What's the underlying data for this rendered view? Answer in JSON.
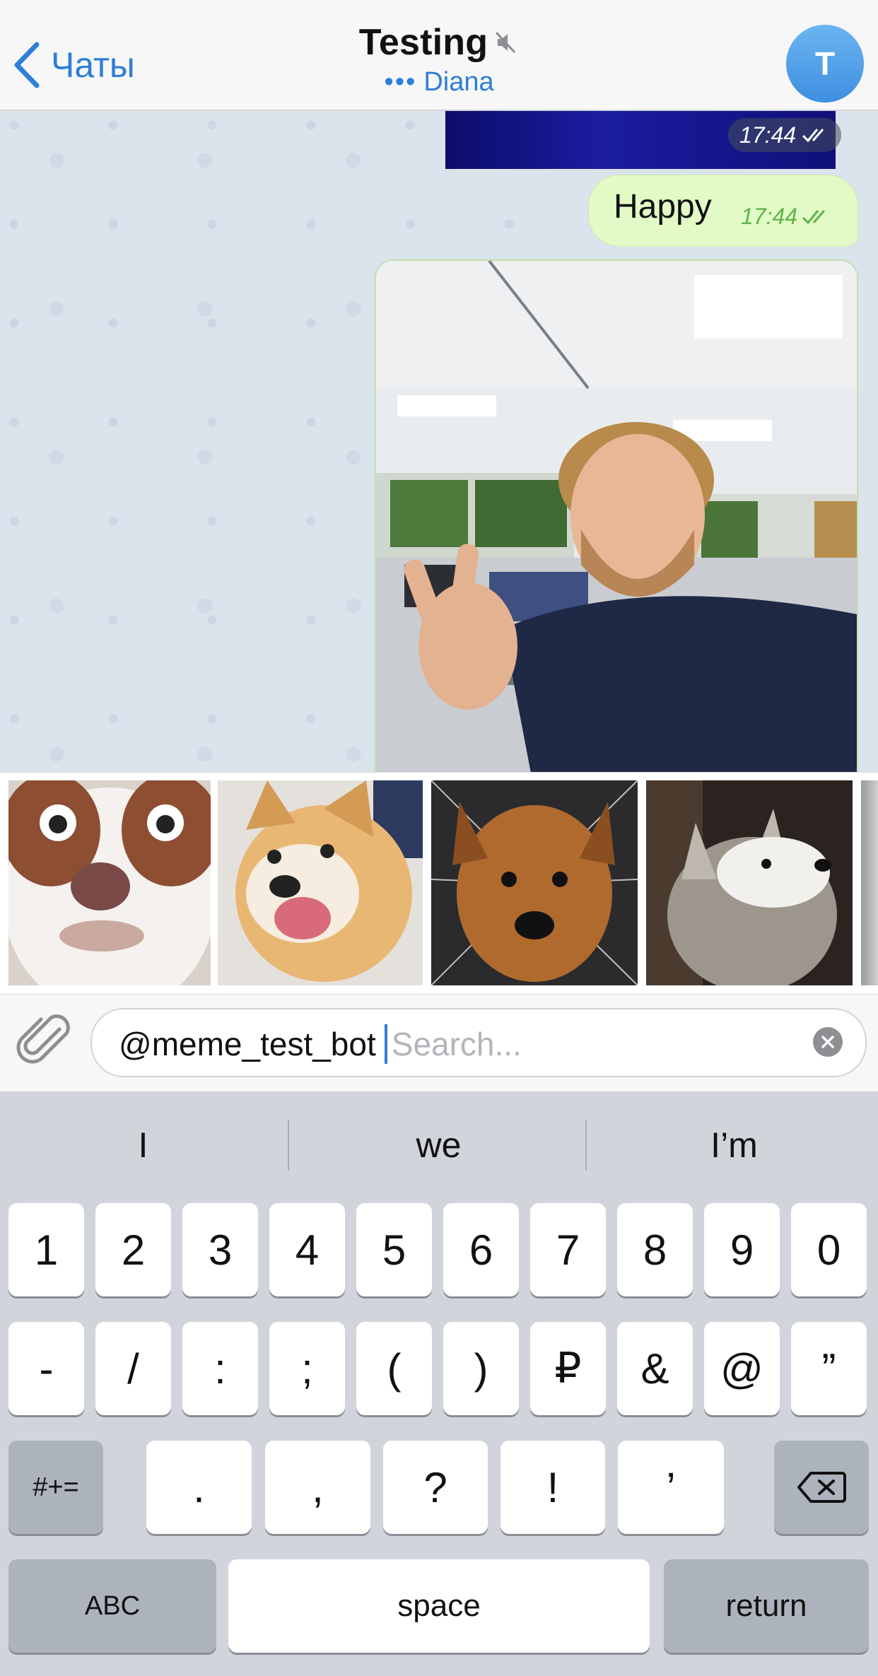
{
  "header": {
    "back_label": "Чаты",
    "title": "Testing",
    "status": "Diana",
    "avatar_letter": "T"
  },
  "messages": {
    "top_media_time": "17:44",
    "text_message": "Happy",
    "text_time": "17:44"
  },
  "inline_results": [
    "dog-meme-1",
    "shiba-meme",
    "dog-meme-2",
    "husky-meme"
  ],
  "input": {
    "value": "@meme_test_bot",
    "placeholder": "Search..."
  },
  "keyboard": {
    "suggestions": [
      "I",
      "we",
      "I’m"
    ],
    "row1": [
      "1",
      "2",
      "3",
      "4",
      "5",
      "6",
      "7",
      "8",
      "9",
      "0"
    ],
    "row2": [
      "-",
      "/",
      ":",
      ";",
      "(",
      ")",
      "₽",
      "&",
      "@",
      "”"
    ],
    "row3": [
      ".",
      ",",
      "?",
      "!",
      "’"
    ],
    "symbols_key": "#+=",
    "abc_key": "ABC",
    "space_key": "space",
    "return_key": "return"
  },
  "colors": {
    "accent": "#2f7ed8",
    "bubble_out": "#e2fbc6",
    "read_check": "#5fb34a"
  }
}
